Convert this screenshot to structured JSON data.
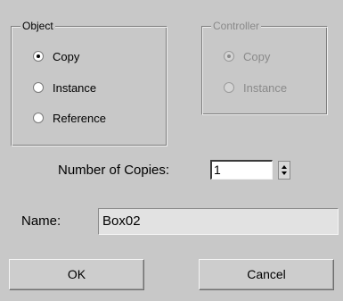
{
  "object_group": {
    "title": "Object",
    "options": [
      {
        "label": "Copy",
        "selected": true
      },
      {
        "label": "Instance",
        "selected": false
      },
      {
        "label": "Reference",
        "selected": false
      }
    ]
  },
  "controller_group": {
    "title": "Controller",
    "enabled": false,
    "options": [
      {
        "label": "Copy",
        "selected": true
      },
      {
        "label": "Instance",
        "selected": false
      }
    ]
  },
  "copies": {
    "label": "Number of Copies:",
    "value": "1"
  },
  "name": {
    "label": "Name:",
    "value": "Box02"
  },
  "buttons": {
    "ok": "OK",
    "cancel": "Cancel"
  }
}
